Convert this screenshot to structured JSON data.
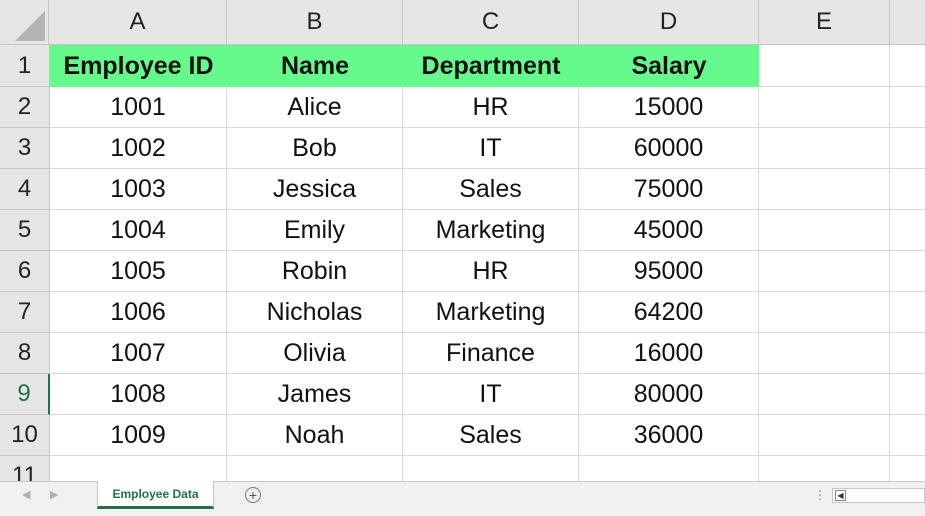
{
  "columns": [
    "A",
    "B",
    "C",
    "D",
    "E"
  ],
  "rows": [
    "1",
    "2",
    "3",
    "4",
    "5",
    "6",
    "7",
    "8",
    "9",
    "10",
    "11"
  ],
  "table": {
    "headers": [
      "Employee ID",
      "Name",
      "Department",
      "Salary"
    ],
    "records": [
      [
        "1001",
        "Alice",
        "HR",
        "15000"
      ],
      [
        "1002",
        "Bob",
        "IT",
        "60000"
      ],
      [
        "1003",
        "Jessica",
        "Sales",
        "75000"
      ],
      [
        "1004",
        "Emily",
        "Marketing",
        "45000"
      ],
      [
        "1005",
        "Robin",
        "HR",
        "95000"
      ],
      [
        "1006",
        "Nicholas",
        "Marketing",
        "64200"
      ],
      [
        "1007",
        "Olivia",
        "Finance",
        "16000"
      ],
      [
        "1008",
        "James",
        "IT",
        "80000"
      ],
      [
        "1009",
        "Noah",
        "Sales",
        "36000"
      ]
    ]
  },
  "active_row": "9",
  "colors": {
    "header_fill": "#66fa8c",
    "accent": "#217346"
  },
  "sheet_tabs": [
    {
      "label": "Employee Data",
      "active": true
    }
  ],
  "icons": {
    "add_sheet": "plus-circle-icon",
    "scroll_left": "triangle-left-icon"
  }
}
